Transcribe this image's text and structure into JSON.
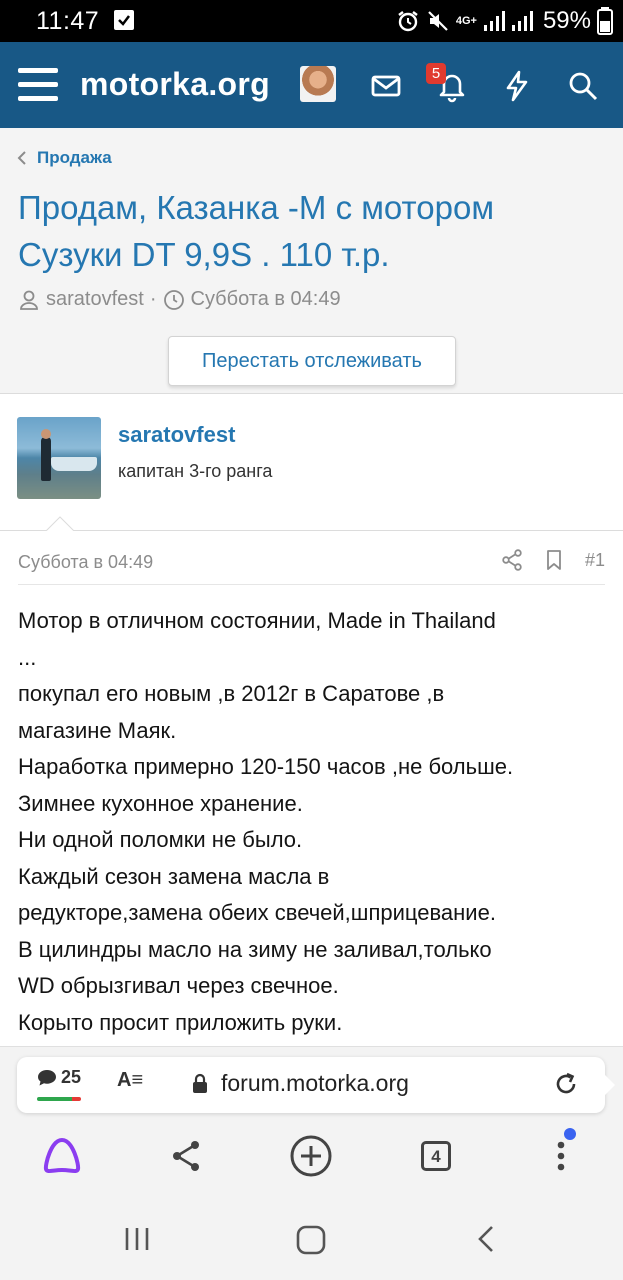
{
  "status_bar": {
    "time": "11:47",
    "network": "4G+",
    "battery": "59%"
  },
  "header": {
    "logo": "motorka.org",
    "notification_count": "5",
    "icons": [
      "menu-icon",
      "avatar",
      "mail-icon",
      "bell-icon",
      "lightning-icon",
      "search-icon"
    ],
    "accent": "#185886"
  },
  "thread": {
    "breadcrumb": "Продажа",
    "title_line1": "Продам, Казанка -М с мотором",
    "title_line2": "Сузуки DT 9,9S . 110 т.р.",
    "author": "saratovfest",
    "date": "Суббота в 04:49",
    "watch_button": "Перестать отслеживать"
  },
  "post": {
    "author": "saratovfest",
    "rank": "капитан 3-го ранга",
    "date": "Суббота в 04:49",
    "number": "#1",
    "lines": [
      "Мотор в отличном состоянии, Made in Thailand",
      "...",
      "покупал его новым ,в 2012г в Саратове ,в",
      "магазине Маяк.",
      "Наработка примерно 120-150 часов ,не больше.",
      "Зимнее кухонное хранение.",
      "Ни одной поломки не было.",
      "Каждый сезон замена масла в",
      "редукторе,замена обеих свечей,шприцевание.",
      "В цилиндры масло на зиму не заливал,только",
      "WD обрызгивал через свечное.",
      "Корыто просит приложить руки."
    ]
  },
  "browser": {
    "comments_count": "25",
    "reader_label": "A≡",
    "url": "forum.motorka.org",
    "tabs_count": "4"
  }
}
